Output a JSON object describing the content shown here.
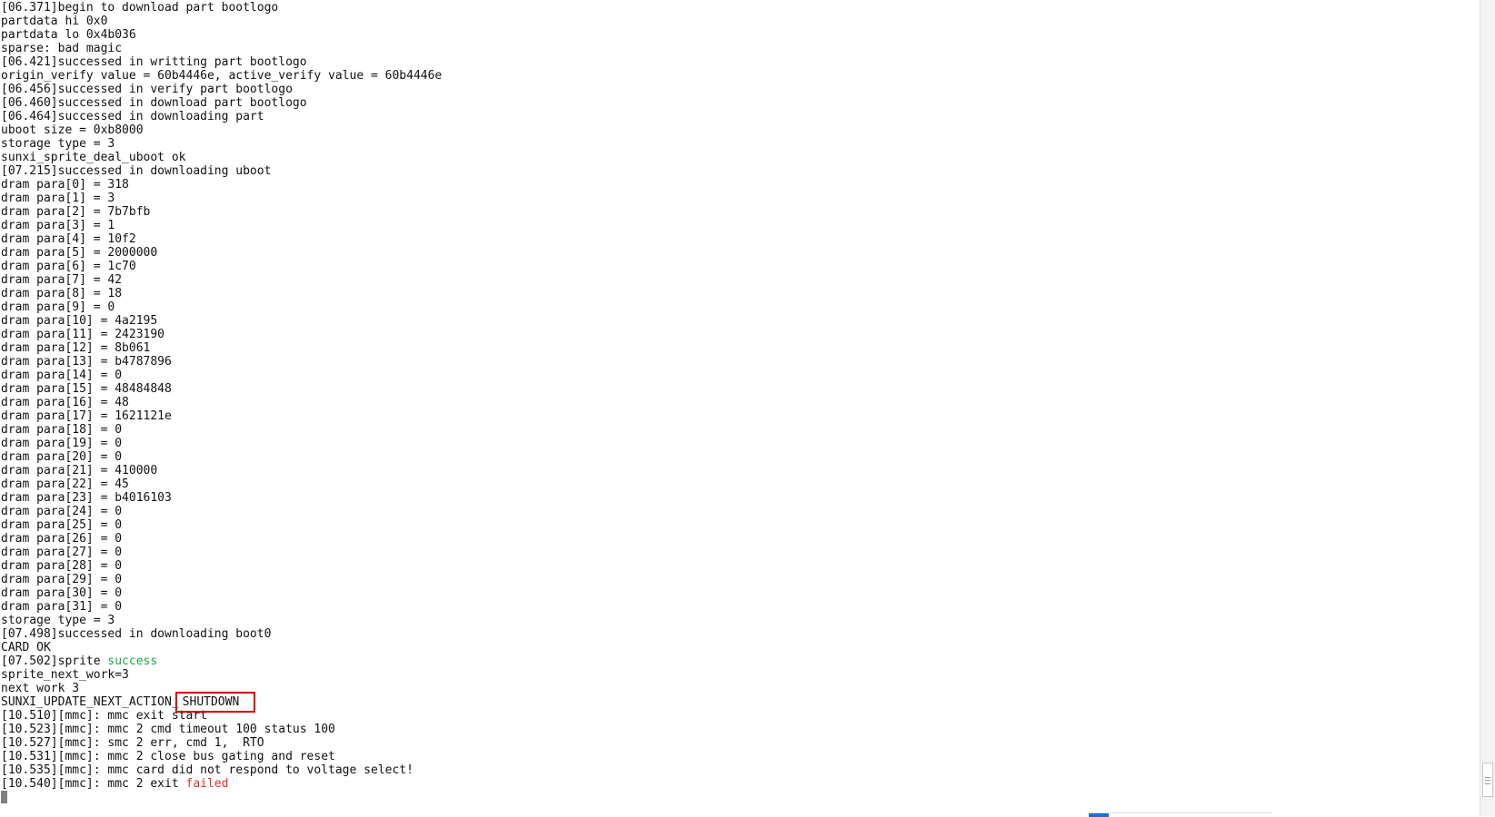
{
  "log": {
    "l01": "[06.371]begin to download part bootlogo",
    "l02": "partdata hi 0x0",
    "l03": "partdata lo 0x4b036",
    "l04": "sparse: bad magic",
    "l05": "[06.421]successed in writting part bootlogo",
    "l06": "origin_verify value = 60b4446e, active_verify value = 60b4446e",
    "l07": "[06.456]successed in verify part bootlogo",
    "l08": "[06.460]successed in download part bootlogo",
    "l09": "[06.464]successed in downloading part",
    "l10": "uboot size = 0xb8000",
    "l11": "storage type = 3",
    "l12": "sunxi_sprite_deal_uboot ok",
    "l13": "[07.215]successed in downloading uboot",
    "dram": [
      "dram para[0] = 318",
      "dram para[1] = 3",
      "dram para[2] = 7b7bfb",
      "dram para[3] = 1",
      "dram para[4] = 10f2",
      "dram para[5] = 2000000",
      "dram para[6] = 1c70",
      "dram para[7] = 42",
      "dram para[8] = 18",
      "dram para[9] = 0",
      "dram para[10] = 4a2195",
      "dram para[11] = 2423190",
      "dram para[12] = 8b061",
      "dram para[13] = b4787896",
      "dram para[14] = 0",
      "dram para[15] = 48484848",
      "dram para[16] = 48",
      "dram para[17] = 1621121e",
      "dram para[18] = 0",
      "dram para[19] = 0",
      "dram para[20] = 0",
      "dram para[21] = 410000",
      "dram para[22] = 45",
      "dram para[23] = b4016103",
      "dram para[24] = 0",
      "dram para[25] = 0",
      "dram para[26] = 0",
      "dram para[27] = 0",
      "dram para[28] = 0",
      "dram para[29] = 0",
      "dram para[30] = 0",
      "dram para[31] = 0"
    ],
    "l46": "storage type = 3",
    "l47": "[07.498]successed in downloading boot0",
    "l48": "CARD OK",
    "l49_prefix": "[07.502]sprite ",
    "l49_status": "success",
    "l50": "sprite_next_work=3",
    "l51": "next work 3",
    "l52_prefix": "SUNXI_UPDATE_NEXT_ACTION_",
    "l52_action": "SHUTDOWN",
    "l53": "[10.510][mmc]: mmc exit start",
    "l54": "[10.523][mmc]: mmc 2 cmd timeout 100 status 100",
    "l55": "[10.527][mmc]: smc 2 err, cmd 1,  RTO",
    "l56": "[10.531][mmc]: mmc 2 close bus gating and reset",
    "l57": "[10.535][mmc]: mmc card did not respond to voltage select!",
    "l58_prefix": "[10.540][mmc]: mmc 2 exit ",
    "l58_status": "failed"
  },
  "colors": {
    "success": "#1aa845",
    "failed": "#e03030",
    "highlight_box": "#d40000",
    "text": "#111111",
    "background": "#ffffff"
  }
}
